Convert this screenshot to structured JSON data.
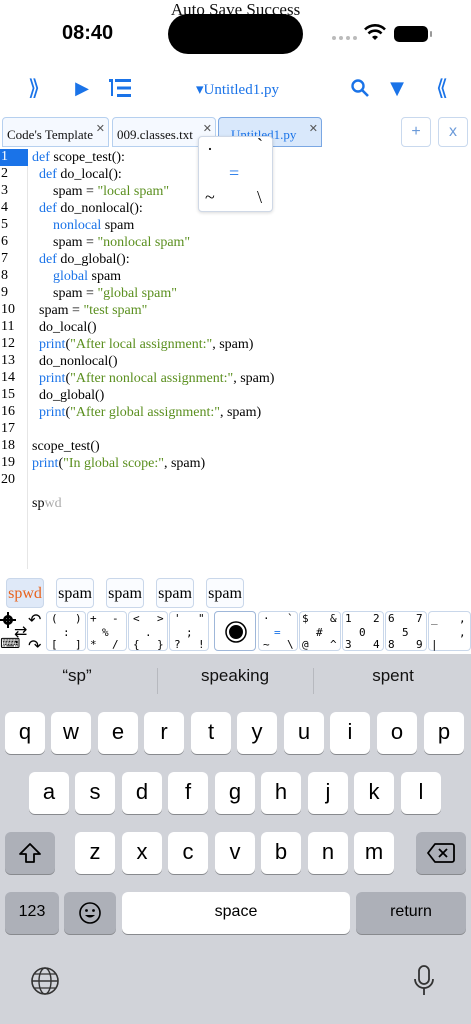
{
  "status": {
    "time": "08:40",
    "toast": "Auto Save Success"
  },
  "toolbar": {
    "expand_left": "⟫",
    "run": "▶",
    "list": "☰",
    "file_title": "▾Untitled1.py",
    "search": "🔍",
    "down": "▼",
    "expand_right": "⟪"
  },
  "tabs": [
    {
      "label": "Code's Template"
    },
    {
      "label": "009.classes.txt"
    },
    {
      "label": "Untitled1.py"
    }
  ],
  "tab_actions": {
    "add": "+",
    "close": "x"
  },
  "editor": {
    "line_numbers": [
      "1",
      "2",
      "3",
      "4",
      "5",
      "6",
      "7",
      "8",
      "9",
      "10",
      "11",
      "12",
      "13",
      "14",
      "15",
      "16",
      "17",
      "18",
      "19",
      "20"
    ],
    "typing": {
      "typed": "sp",
      "ghost": "wd"
    }
  },
  "popup": {
    "dot": "·",
    "tick": "`",
    "equals": "=",
    "tilde": "~",
    "backslash": "\\"
  },
  "suggestions": [
    "spwd",
    "spam",
    "spam",
    "spam",
    "spam"
  ],
  "keyboard": {
    "predictions": [
      "“sp”",
      "speaking",
      "spent"
    ],
    "row1": [
      "q",
      "w",
      "e",
      "r",
      "t",
      "y",
      "u",
      "i",
      "o",
      "p"
    ],
    "row2": [
      "a",
      "s",
      "d",
      "f",
      "g",
      "h",
      "j",
      "k",
      "l"
    ],
    "row3": [
      "z",
      "x",
      "c",
      "v",
      "b",
      "n",
      "m"
    ],
    "numbers_key": "123",
    "space_key": "space",
    "return_key": "return"
  }
}
